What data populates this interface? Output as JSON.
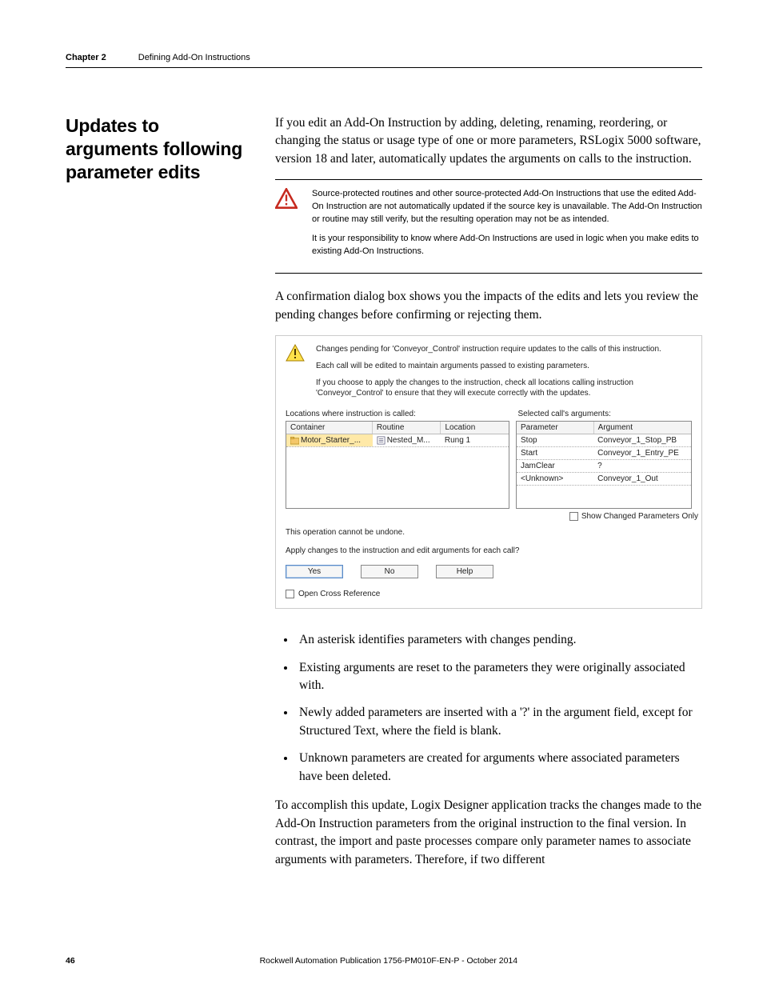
{
  "header": {
    "chapter": "Chapter 2",
    "title": "Defining Add-On Instructions"
  },
  "side_heading": "Updates to arguments following parameter edits",
  "intro": "If you edit an Add-On Instruction by adding, deleting, renaming, reordering, or changing the status or usage type of one or more parameters, RSLogix 5000 software, version 18 and later, automatically updates the arguments on calls to the instruction.",
  "attention": {
    "p1": "Source-protected routines and other source-protected Add-On Instructions that use the edited Add-On Instruction are not automatically updated if the source key is unavailable. The Add-On Instruction or routine may still verify, but the resulting operation may not be as intended.",
    "p2": "It is your responsibility to know where Add-On Instructions are used in logic when you make edits to existing Add-On Instructions."
  },
  "confirm_para": "A confirmation dialog box shows you the impacts of the edits and lets you review the pending changes before confirming or rejecting them.",
  "dialog": {
    "msg1": "Changes pending for 'Conveyor_Control' instruction require updates to the calls of this instruction.",
    "msg2": "Each call will be edited to maintain arguments passed to existing parameters.",
    "msg3": "If you choose to apply the changes to the instruction, check all locations calling instruction 'Conveyor_Control' to ensure that they will execute correctly with the updates.",
    "left_label": "Locations where instruction is called:",
    "right_label": "Selected call's arguments:",
    "left_headers": {
      "a": "Container",
      "b": "Routine",
      "c": "Location"
    },
    "right_headers": {
      "a": "Parameter",
      "b": "Argument"
    },
    "left_row": {
      "a": "Motor_Starter_...",
      "b": "Nested_M...",
      "c": "Rung 1"
    },
    "right_rows": [
      {
        "a": "Stop",
        "b": "Conveyor_1_Stop_PB"
      },
      {
        "a": "Start",
        "b": "Conveyor_1_Entry_PE"
      },
      {
        "a": "JamClear",
        "b": "?"
      },
      {
        "a": "<Unknown>",
        "b": "Conveyor_1_Out"
      }
    ],
    "changed_only": "Show Changed Parameters Only",
    "cannot_undo": "This operation cannot be undone.",
    "apply_q": "Apply changes to the instruction and edit arguments for each call?",
    "yes": "Yes",
    "no": "No",
    "help": "Help",
    "open_xref": "Open Cross Reference"
  },
  "bullets": [
    "An asterisk identifies parameters with changes pending.",
    "Existing arguments are reset to the parameters they were originally associated with.",
    "Newly added parameters are inserted with a '?' in the argument field, except for Structured Text, where the field is blank.",
    "Unknown parameters are created for arguments where associated parameters have been deleted."
  ],
  "closing": "To accomplish this update, Logix Designer application tracks the changes made to the Add-On Instruction parameters from the original instruction to the final version. In contrast, the import and paste processes compare only parameter names to associate arguments with parameters. Therefore, if two different",
  "footer": {
    "page": "46",
    "pub": "Rockwell Automation Publication 1756-PM010F-EN-P - October 2014"
  }
}
